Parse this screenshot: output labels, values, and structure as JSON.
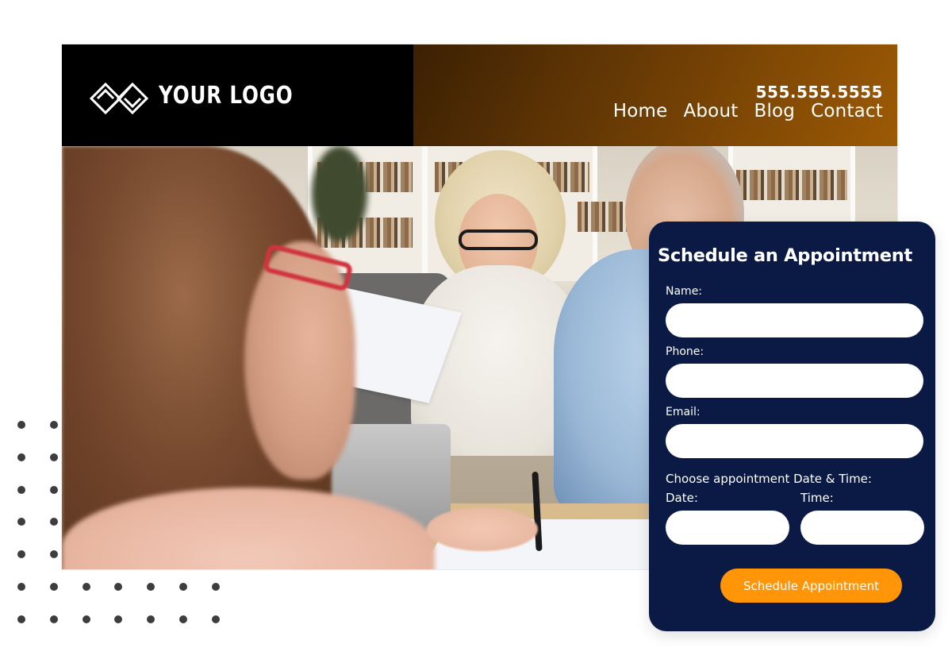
{
  "header": {
    "logo_text": "YOUR LOGO",
    "logo_icon": "interlocking-diamonds-logo-icon",
    "phone": "555.555.5555",
    "nav": [
      {
        "label": "Home"
      },
      {
        "label": "About"
      },
      {
        "label": "Blog"
      },
      {
        "label": "Contact"
      }
    ]
  },
  "hero": {
    "image_description": "Financial advisor with red glasses meeting an elderly couple reviewing documents at a table with a laptop, bookshelves in background"
  },
  "appointment_form": {
    "title": "Schedule an Appointment",
    "fields": {
      "name": {
        "label": "Name:",
        "value": "",
        "placeholder": ""
      },
      "phone": {
        "label": "Phone:",
        "value": "",
        "placeholder": ""
      },
      "email": {
        "label": "Email:",
        "value": "",
        "placeholder": ""
      }
    },
    "datetime_heading": "Choose appointment Date & Time:",
    "date": {
      "label": "Date:",
      "value": "",
      "placeholder": ""
    },
    "time": {
      "label": "Time:",
      "value": "",
      "placeholder": ""
    },
    "submit_label": "Schedule Appointment"
  },
  "colors": {
    "card_background": "#0b1a45",
    "accent_button": "#ff9507",
    "header_logo_panel": "#000000",
    "header_nav_gradient_start": "#3b2003",
    "header_nav_gradient_end": "#9c5a04",
    "dot_color": "#3d3d3d"
  },
  "decoration": {
    "dot_grid": {
      "rows": 7,
      "columns": 7
    }
  }
}
